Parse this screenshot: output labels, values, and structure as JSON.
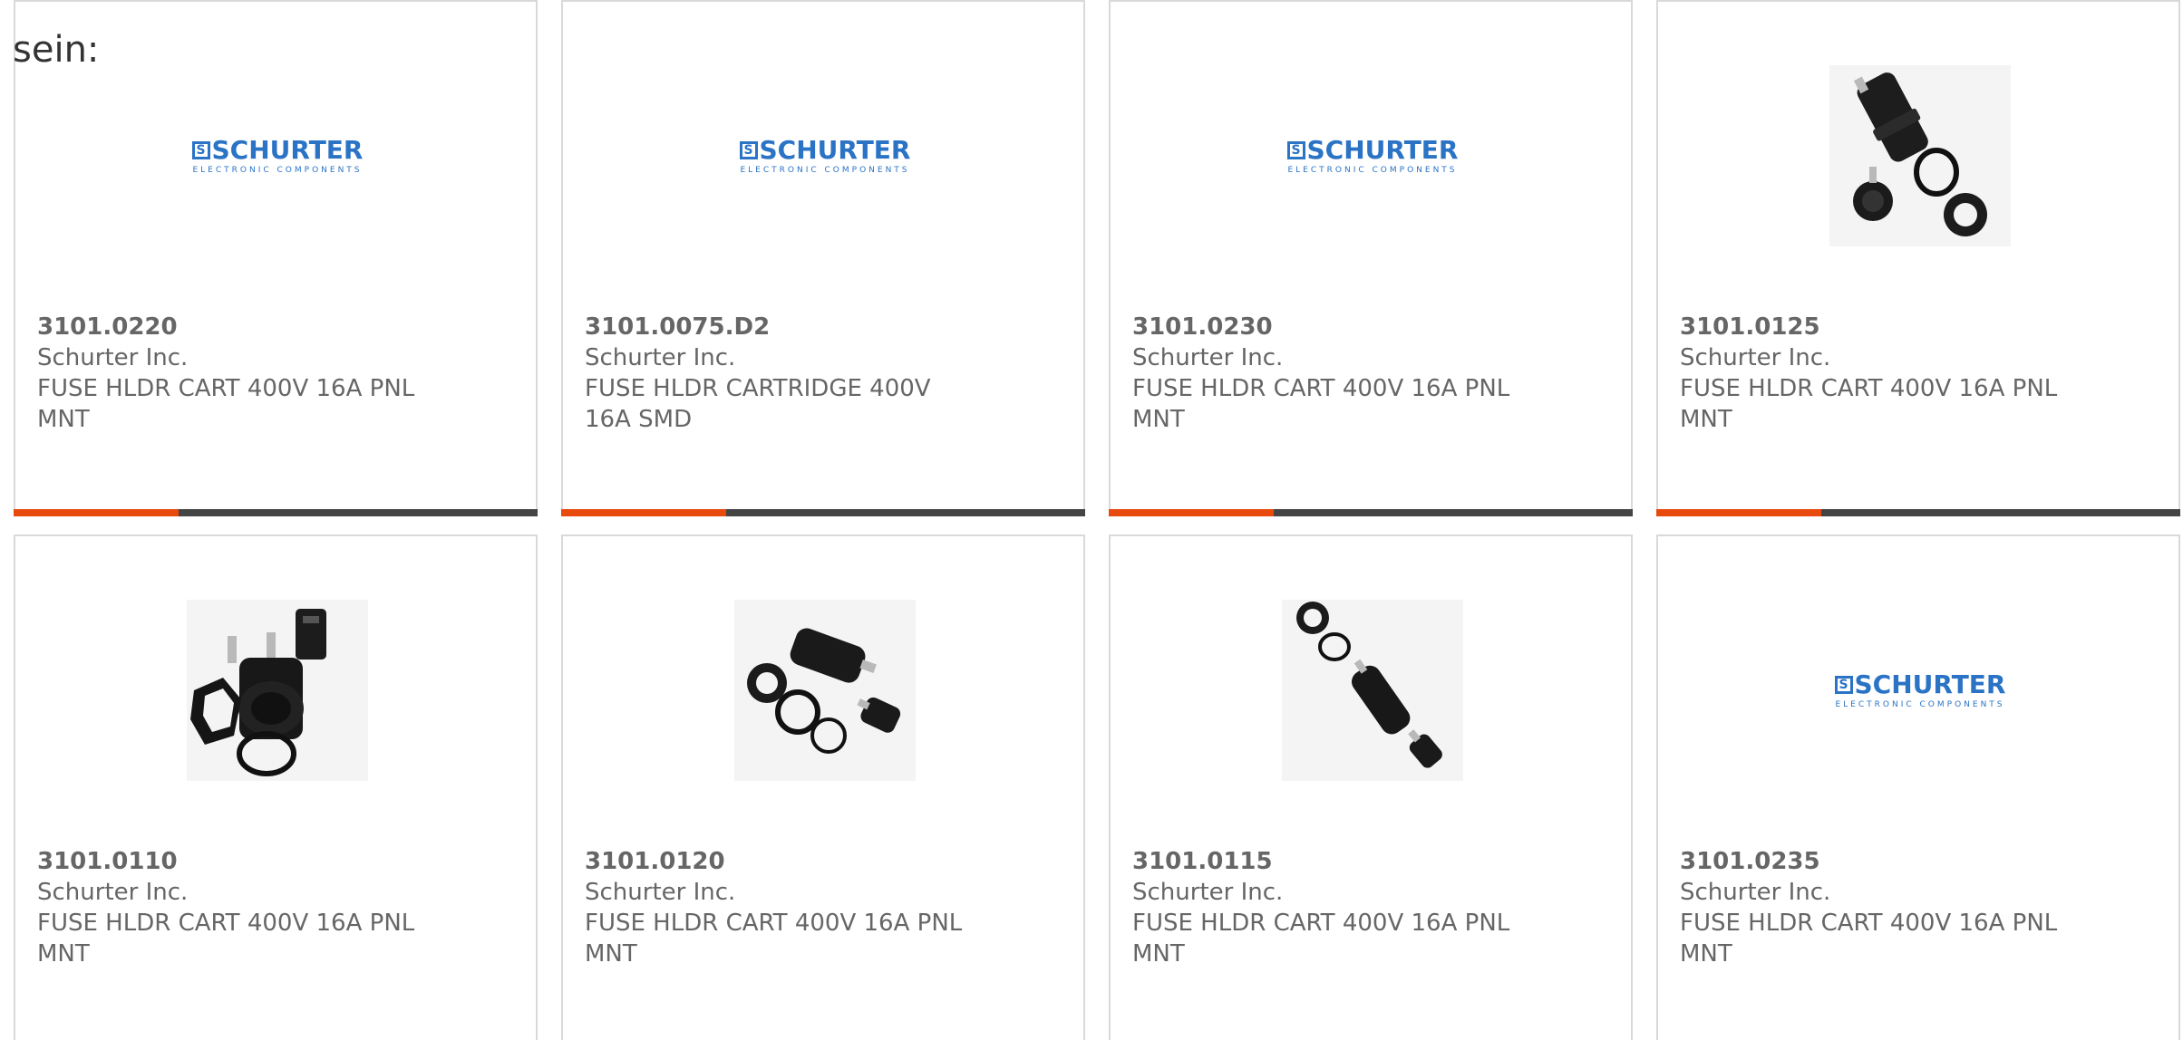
{
  "intro_text": "sein:",
  "colors": {
    "accent": "#e84a0e",
    "bar": "#444444",
    "logo_blue": "#2a73c5",
    "card_border": "#d9d9d9"
  },
  "logo": {
    "mark": "S",
    "word": "SCHURTER",
    "sub": "ELECTRONIC COMPONENTS"
  },
  "products": [
    {
      "part": "3101.0220",
      "manufacturer": "Schurter Inc.",
      "desc1": "FUSE HLDR CART 400V 16A PNL",
      "desc2": "MNT",
      "image": "schurter-logo"
    },
    {
      "part": "3101.0075.D2",
      "manufacturer": "Schurter Inc.",
      "desc1": "FUSE HLDR CARTRIDGE 400V",
      "desc2": "16A SMD",
      "image": "schurter-logo"
    },
    {
      "part": "3101.0230",
      "manufacturer": "Schurter Inc.",
      "desc1": "FUSE HLDR CART 400V 16A PNL",
      "desc2": "MNT",
      "image": "schurter-logo"
    },
    {
      "part": "3101.0125",
      "manufacturer": "Schurter Inc.",
      "desc1": "FUSE HLDR CART 400V 16A PNL",
      "desc2": "MNT",
      "image": "fuse-holder-photo"
    },
    {
      "part": "3101.0110",
      "manufacturer": "Schurter Inc.",
      "desc1": "FUSE HLDR CART 400V 16A PNL",
      "desc2": "MNT",
      "image": "fuse-holder-photo"
    },
    {
      "part": "3101.0120",
      "manufacturer": "Schurter Inc.",
      "desc1": "FUSE HLDR CART 400V 16A PNL",
      "desc2": "MNT",
      "image": "fuse-holder-photo"
    },
    {
      "part": "3101.0115",
      "manufacturer": "Schurter Inc.",
      "desc1": "FUSE HLDR CART 400V 16A PNL",
      "desc2": "MNT",
      "image": "fuse-holder-photo"
    },
    {
      "part": "3101.0235",
      "manufacturer": "Schurter Inc.",
      "desc1": "FUSE HLDR CART 400V 16A PNL",
      "desc2": "MNT",
      "image": "schurter-logo"
    }
  ]
}
